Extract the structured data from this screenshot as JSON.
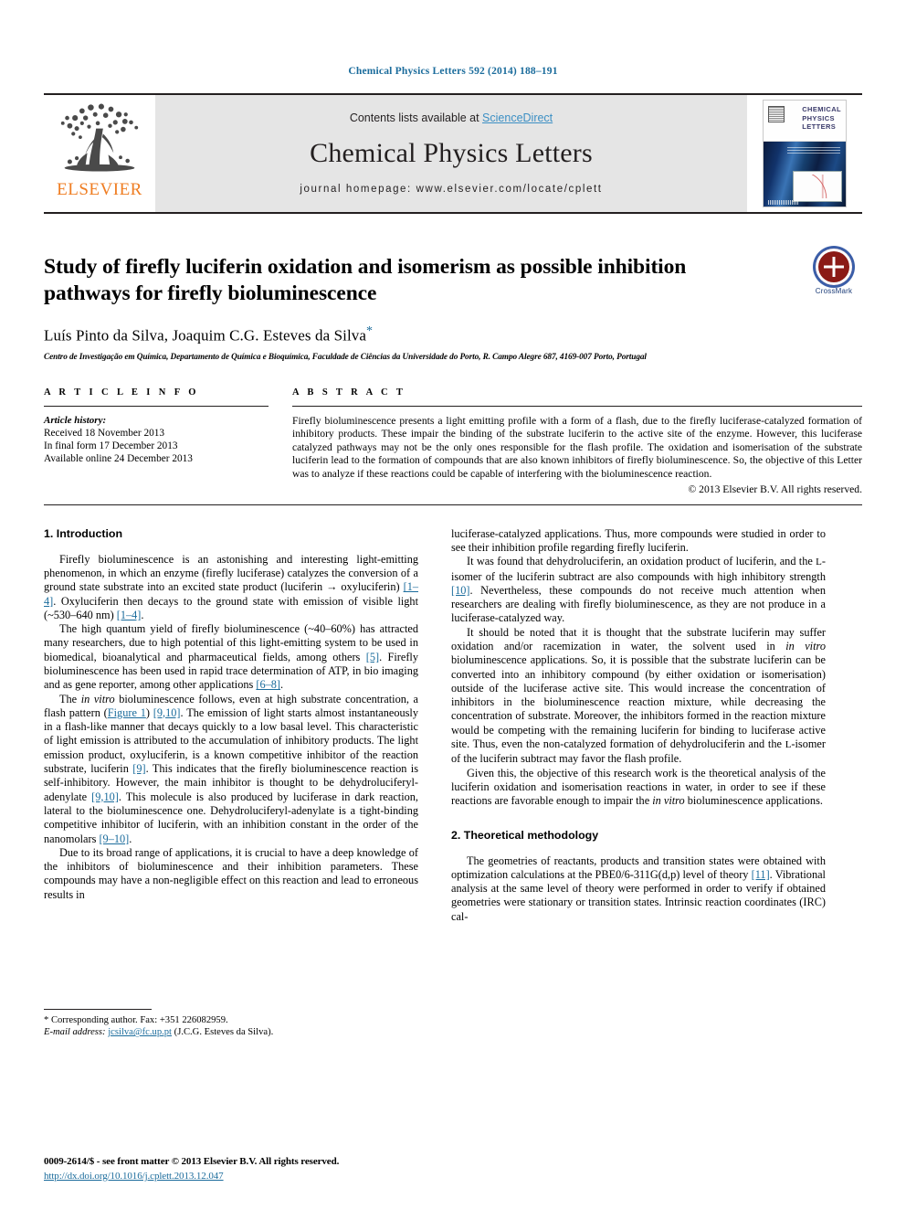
{
  "running_head": "Chemical Physics Letters 592 (2014) 188–191",
  "masthead": {
    "publisher_name": "ELSEVIER",
    "contents_prefix": "Contents lists available at ",
    "contents_link": "ScienceDirect",
    "journal_title": "Chemical Physics Letters",
    "homepage": "journal homepage: www.elsevier.com/locate/cplett",
    "cover_title_lines": [
      "CHEMICAL",
      "PHYSICS",
      "LETTERS"
    ]
  },
  "article": {
    "title": "Study of firefly luciferin oxidation and isomerism as possible inhibition pathways for firefly bioluminescence",
    "authors": "Luís Pinto da Silva, Joaquim C.G. Esteves da Silva",
    "corresponding_marker": "*",
    "affiliation": "Centro de Investigação em Química, Departamento de Química e Bioquímica, Faculdade de Ciências da Universidade do Porto, R. Campo Alegre 687, 4169-007 Porto, Portugal",
    "crossmark_label": "CrossMark"
  },
  "article_info": {
    "heading": "A R T I C L E    I N F O",
    "history_label": "Article history:",
    "history_lines": [
      "Received 18 November 2013",
      "In final form 17 December 2013",
      "Available online 24 December 2013"
    ]
  },
  "abstract": {
    "heading": "A B S T R A C T",
    "text": "Firefly bioluminescence presents a light emitting profile with a form of a flash, due to the firefly luciferase-catalyzed formation of inhibitory products. These impair the binding of the substrate luciferin to the active site of the enzyme. However, this luciferase catalyzed pathways may not be the only ones responsible for the flash profile. The oxidation and isomerisation of the substrate luciferin lead to the formation of compounds that are also known inhibitors of firefly bioluminescence. So, the objective of this Letter was to analyze if these reactions could be capable of interfering with the bioluminescence reaction.",
    "copyright": "© 2013 Elsevier B.V. All rights reserved."
  },
  "sections": {
    "introduction_heading": "1. Introduction",
    "methodology_heading": "2. Theoretical methodology"
  },
  "left_column": {
    "paragraphs": [
      {
        "parts": [
          {
            "t": "Firefly bioluminescence is an astonishing and interesting light-emitting phenomenon, in which an enzyme (firefly luciferase) catalyzes the conversion of a ground state substrate into an excited state product (luciferin → oxyluciferin) ",
            "k": "n"
          },
          {
            "t": "[1–4]",
            "k": "c"
          },
          {
            "t": ". Oxyluciferin then decays to the ground state with emission of visible light (~530–640 nm) ",
            "k": "n"
          },
          {
            "t": "[1–4]",
            "k": "c"
          },
          {
            "t": ".",
            "k": "n"
          }
        ]
      },
      {
        "parts": [
          {
            "t": "The high quantum yield of firefly bioluminescence (~40–60%) has attracted many researchers, due to high potential of this light-emitting system to be used in biomedical, bioanalytical and pharmaceutical fields, among others ",
            "k": "n"
          },
          {
            "t": "[5]",
            "k": "c"
          },
          {
            "t": ". Firefly bioluminescence has been used in rapid trace determination of ATP, in bio imaging and as gene reporter, among other applications ",
            "k": "n"
          },
          {
            "t": "[6–8]",
            "k": "c"
          },
          {
            "t": ".",
            "k": "n"
          }
        ]
      },
      {
        "parts": [
          {
            "t": "The ",
            "k": "n"
          },
          {
            "t": "in vitro",
            "k": "i"
          },
          {
            "t": " bioluminescence follows, even at high substrate concentration, a flash pattern (",
            "k": "n"
          },
          {
            "t": "Figure 1",
            "k": "c"
          },
          {
            "t": ") ",
            "k": "n"
          },
          {
            "t": "[9,10]",
            "k": "c"
          },
          {
            "t": ". The emission of light starts almost instantaneously in a flash-like manner that decays quickly to a low basal level. This characteristic of light emission is attributed to the accumulation of inhibitory products. The light emission product, oxyluciferin, is a known competitive inhibitor of the reaction substrate, luciferin ",
            "k": "n"
          },
          {
            "t": "[9]",
            "k": "c"
          },
          {
            "t": ". This indicates that the firefly bioluminescence reaction is self-inhibitory. However, the main inhibitor is thought to be dehydroluciferyl-adenylate ",
            "k": "n"
          },
          {
            "t": "[9,10]",
            "k": "c"
          },
          {
            "t": ". This molecule is also produced by luciferase in dark reaction, lateral to the bioluminescence one. Dehydroluciferyl-adenylate is a tight-binding competitive inhibitor of luciferin, with an inhibition constant in the order of the nanomolars ",
            "k": "n"
          },
          {
            "t": "[9–10]",
            "k": "c"
          },
          {
            "t": ".",
            "k": "n"
          }
        ]
      },
      {
        "parts": [
          {
            "t": "Due to its broad range of applications, it is crucial to have a deep knowledge of the inhibitors of bioluminescence and their inhibition parameters. These compounds may have a non-negligible effect on this reaction and lead to erroneous results in",
            "k": "n"
          }
        ]
      }
    ]
  },
  "right_column": {
    "paragraphs": [
      {
        "parts": [
          {
            "t": "luciferase-catalyzed applications. Thus, more compounds were studied in order to see their inhibition profile regarding firefly luciferin.",
            "k": "n"
          }
        ],
        "noindent": true
      },
      {
        "parts": [
          {
            "t": "It was found that dehydroluciferin, an oxidation product of luciferin, and the ",
            "k": "n"
          },
          {
            "t": "L",
            "k": "sc"
          },
          {
            "t": "-isomer of the luciferin subtract are also compounds with high inhibitory strength ",
            "k": "n"
          },
          {
            "t": "[10]",
            "k": "c"
          },
          {
            "t": ". Nevertheless, these compounds do not receive much attention when researchers are dealing with firefly bioluminescence, as they are not produce in a luciferase-catalyzed way.",
            "k": "n"
          }
        ]
      },
      {
        "parts": [
          {
            "t": "It should be noted that it is thought that the substrate luciferin may suffer oxidation and/or racemization in water, the solvent used in ",
            "k": "n"
          },
          {
            "t": "in vitro",
            "k": "i"
          },
          {
            "t": " bioluminescence applications. So, it is possible that the substrate luciferin can be converted into an inhibitory compound (by either oxidation or isomerisation) outside of the luciferase active site. This would increase the concentration of inhibitors in the bioluminescence reaction mixture, while decreasing the concentration of substrate. Moreover, the inhibitors formed in the reaction mixture would be competing with the remaining luciferin for binding to luciferase active site. Thus, even the non-catalyzed formation of dehydroluciferin and the ",
            "k": "n"
          },
          {
            "t": "L",
            "k": "sc"
          },
          {
            "t": "-isomer of the luciferin subtract may favor the flash profile.",
            "k": "n"
          }
        ]
      },
      {
        "parts": [
          {
            "t": "Given this, the objective of this research work is the theoretical analysis of the luciferin oxidation and isomerisation reactions in water, in order to see if these reactions are favorable enough to impair the ",
            "k": "n"
          },
          {
            "t": "in vitro",
            "k": "i"
          },
          {
            "t": " bioluminescence applications.",
            "k": "n"
          }
        ]
      }
    ],
    "methodology_paragraphs": [
      {
        "parts": [
          {
            "t": "The geometries of reactants, products and transition states were obtained with optimization calculations at the PBE0/6-311G(d,p) level of theory ",
            "k": "n"
          },
          {
            "t": "[11]",
            "k": "c"
          },
          {
            "t": ". Vibrational analysis at the same level of theory were performed in order to verify if obtained geometries were stationary or transition states. Intrinsic reaction coordinates (IRC) cal-",
            "k": "n"
          }
        ]
      }
    ]
  },
  "footnote": {
    "corresponding": "* Corresponding author. Fax: +351 226082959.",
    "email_label": "E-mail address:",
    "email": "jcsilva@fc.up.pt",
    "email_suffix": "(J.C.G. Esteves da Silva)."
  },
  "imprint": {
    "line1": "0009-2614/$ - see front matter © 2013 Elsevier B.V. All rights reserved.",
    "line2": "http://dx.doi.org/10.1016/j.cplett.2013.12.047"
  },
  "colors": {
    "link": "#1b6c9c",
    "elsevier_orange": "#ef7d22",
    "banner_bg": "#e5e5e5",
    "crossmark_red": "#8b1a16"
  }
}
